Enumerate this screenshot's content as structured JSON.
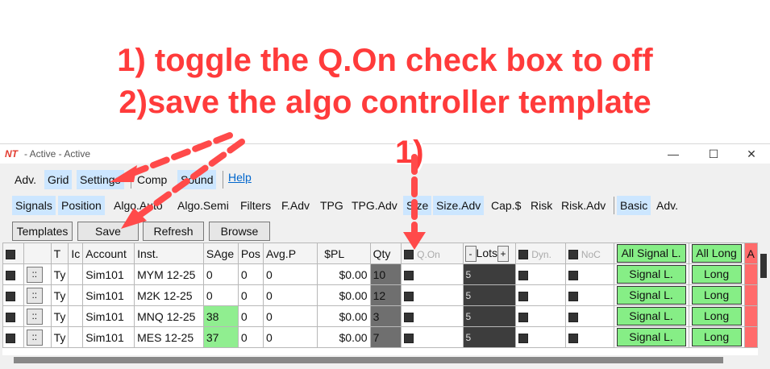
{
  "annotations": {
    "line1": "1) toggle the Q.On  check box to off",
    "line2": "2)save the algo controller template",
    "marker": "1)"
  },
  "window": {
    "logo": "NT",
    "title": "- Active - Active",
    "minimize": "—",
    "maximize": "☐",
    "close": "✕"
  },
  "menu1": [
    {
      "label": "Adv.",
      "selected": false
    },
    {
      "label": "Grid",
      "selected": true
    },
    {
      "label": "Settings",
      "selected": true
    },
    {
      "label": "Comp",
      "selected": false
    },
    {
      "label": "Sound",
      "selected": true
    },
    {
      "label": "Help",
      "selected": false
    }
  ],
  "menu2": [
    {
      "label": "Signals",
      "selected": true
    },
    {
      "label": "Position",
      "selected": true
    },
    {
      "label": "Algo.Auto",
      "selected": false
    },
    {
      "label": "Algo.Semi",
      "selected": false
    },
    {
      "label": "Filters",
      "selected": false
    },
    {
      "label": "F.Adv",
      "selected": false
    },
    {
      "label": "TPG",
      "selected": false
    },
    {
      "label": "TPG.Adv",
      "selected": false
    },
    {
      "label": "Size",
      "selected": true
    },
    {
      "label": "Size.Adv",
      "selected": true
    },
    {
      "label": "Cap.$",
      "selected": false
    },
    {
      "label": "Risk",
      "selected": false
    },
    {
      "label": "Risk.Adv",
      "selected": false
    },
    {
      "label": "Basic",
      "selected": true
    },
    {
      "label": "Adv.",
      "selected": false
    }
  ],
  "buttons": {
    "templates": "Templates",
    "save": "Save",
    "refresh": "Refresh",
    "browse": "Browse"
  },
  "grid": {
    "headers": {
      "t": "T",
      "ic": "Ic",
      "account": "Account",
      "inst": "Inst.",
      "sage": "SAge",
      "pos": "Pos",
      "avgp": "Avg.P",
      "pl": "$PL",
      "qty": "Qty",
      "qon": "Q.On",
      "lots_minus": "-",
      "lots": "Lots",
      "lots_plus": "+",
      "dyn": "Dyn.",
      "noc": "NoC",
      "all_signal": "All Signal L.",
      "all_long": "All Long",
      "all_a": "A"
    },
    "rows": [
      {
        "t": "Ty",
        "account": "Sim101",
        "inst": "MYM 12-25",
        "sage": "0",
        "sage_green": false,
        "pos": "0",
        "avgp": "0",
        "pl": "$0.00",
        "qty": "10",
        "lots": "5",
        "signal": "Signal L.",
        "long": "Long"
      },
      {
        "t": "Ty",
        "account": "Sim101",
        "inst": "M2K 12-25",
        "sage": "0",
        "sage_green": false,
        "pos": "0",
        "avgp": "0",
        "pl": "$0.00",
        "qty": "12",
        "lots": "5",
        "signal": "Signal L.",
        "long": "Long"
      },
      {
        "t": "Ty",
        "account": "Sim101",
        "inst": "MNQ 12-25",
        "sage": "38",
        "sage_green": true,
        "pos": "0",
        "avgp": "0",
        "pl": "$0.00",
        "qty": "3",
        "lots": "5",
        "signal": "Signal L.",
        "long": "Long"
      },
      {
        "t": "Ty",
        "account": "Sim101",
        "inst": "MES 12-25",
        "sage": "37",
        "sage_green": true,
        "pos": "0",
        "avgp": "0",
        "pl": "$0.00",
        "qty": "7",
        "lots": "5",
        "signal": "Signal L.",
        "long": "Long"
      }
    ],
    "drag_glyph": "::"
  },
  "colors": {
    "annotation": "#ff3b3b",
    "selected_tab": "#cce6ff",
    "green_button": "#86ee86",
    "age_green": "#90ee90",
    "red_cell": "#ff6b6b"
  }
}
